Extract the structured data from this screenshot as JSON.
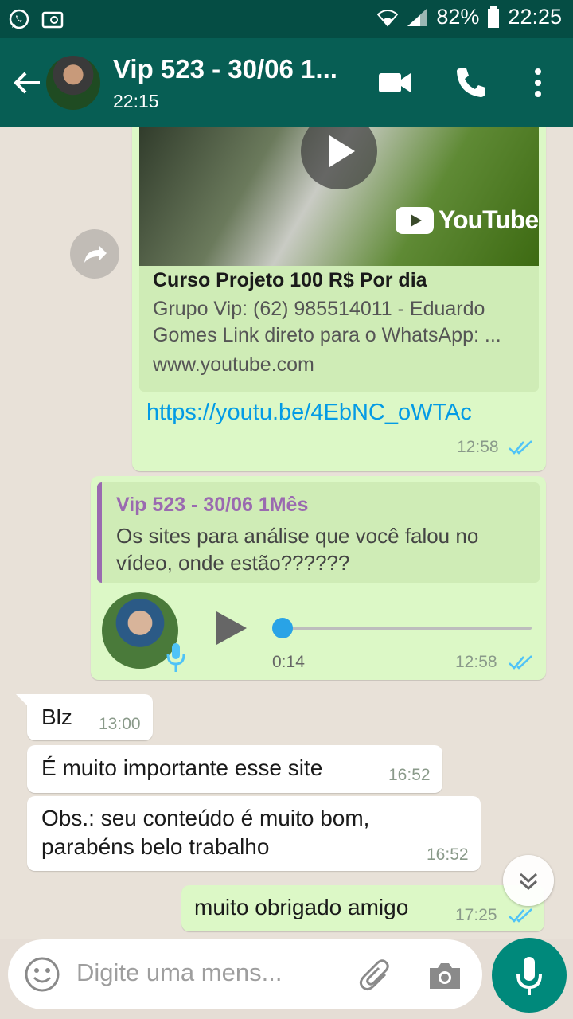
{
  "status": {
    "battery": "82%",
    "time": "22:25"
  },
  "header": {
    "title": "Vip 523 - 30/06 1...",
    "subtitle": "22:15"
  },
  "messages": {
    "link_preview": {
      "youtube_label": "YouTube",
      "title": "Curso Projeto 100 R$ Por dia",
      "description": "Grupo Vip: (62) 985514011 - Eduardo Gomes Link direto para o WhatsApp: ...",
      "domain": "www.youtube.com",
      "url": "https://youtu.be/4EbNC_oWTAc",
      "time": "12:58"
    },
    "voice": {
      "quote_author": "Vip 523 - 30/06 1Mês",
      "quote_text": "Os sites para análise que você falou no vídeo, onde estão??????",
      "duration": "0:14",
      "time": "12:58"
    },
    "in1": {
      "text": "Blz",
      "time": "13:00"
    },
    "in2": {
      "text": "É muito importante esse site",
      "time": "16:52"
    },
    "in3": {
      "line1": "Obs.: seu conteúdo é muito bom,",
      "line2": "parabéns belo trabalho",
      "time": "16:52"
    },
    "out1": {
      "text": "muito obrigado amigo",
      "time": "17:25"
    }
  },
  "composer": {
    "placeholder": "Digite uma mens..."
  },
  "colors": {
    "header": "#075e54",
    "status": "#054d44",
    "out_bubble": "#dcf8c6",
    "accent": "#00897b",
    "link": "#039be5",
    "tick": "#4fc3f7"
  }
}
